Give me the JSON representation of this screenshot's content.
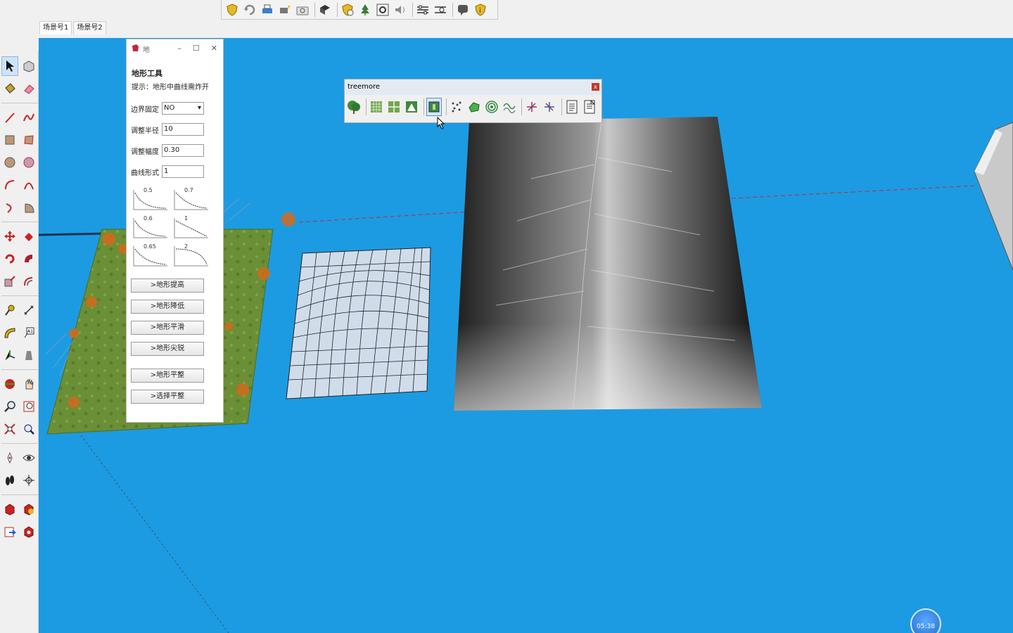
{
  "scene_tabs": [
    "场景号1",
    "场景号2"
  ],
  "terrain_dialog": {
    "title": "地",
    "heading": "地形工具",
    "hint": "提示：地形中曲线需炸开",
    "fields": [
      {
        "label": "边界固定",
        "value": "NO"
      },
      {
        "label": "调整半径",
        "value": "10"
      },
      {
        "label": "调整幅度",
        "value": "0.30"
      },
      {
        "label": "曲线形式",
        "value": "1"
      }
    ],
    "curves": [
      "0.5",
      "0.7",
      "0.6",
      "1",
      "0.65",
      "2"
    ],
    "buttons": [
      ">地形提高",
      ">地形降低",
      ">地形平滑",
      ">地形尖锐",
      ">地形平整",
      ">选择平整"
    ]
  },
  "treemore": {
    "title": "treemore",
    "close": "x"
  },
  "timestamp": "05:38",
  "colors": {
    "viewport_bg": "#1c9be2",
    "axis_red": "#c0283a"
  }
}
